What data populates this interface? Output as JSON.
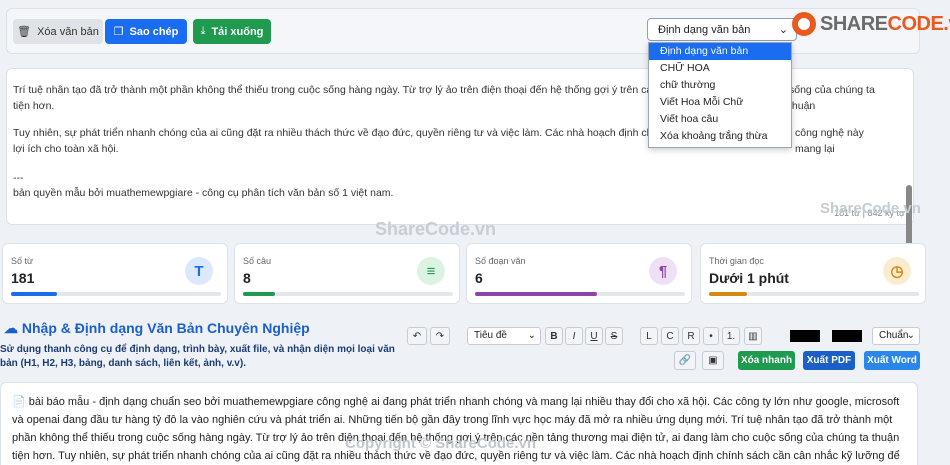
{
  "toolbar": {
    "clear_label": "Xóa văn bản",
    "copy_label": "Sao chép",
    "download_label": "Tải xuống"
  },
  "format_select": {
    "selected": "Định dạng văn bản",
    "options": [
      "Định dạng văn bản",
      "CHỮ HOA",
      "chữ thường",
      "Viết Hoa Mỗi Chữ",
      "Viết hoa câu",
      "Xóa khoảng trắng thừa"
    ]
  },
  "logo": {
    "share": "SHARE",
    "code": "CODE.vn"
  },
  "textarea": {
    "line1": "Trí tuệ nhân tạo đã trở thành một phần không thể thiếu trong cuộc sống hàng ngày. Từ trợ lý ảo trên điện thoại đến hệ thống gợi ý trên các nền tảng",
    "line1b": "sống của chúng ta thuận",
    "line2": "tiện hơn.",
    "line3": "Tuy nhiên, sự phát triển nhanh chóng của ai cũng đặt ra nhiều thách thức về đạo đức, quyền riêng tư và việc làm. Các nhà hoạch định chính sách cầ",
    "line3b": "công nghệ này mang lại",
    "line4": "lợi ích cho toàn xã hội.",
    "line5": "---",
    "line6": "bản quyền mẫu bởi muathemewpgiare - công cụ phân tích văn bản số 1 việt nam.",
    "counter": "181 từ | 842 ký tự"
  },
  "watermarks": {
    "mid": "ShareCode.vn",
    "right": "ShareCode.vn",
    "bottom": "Copyright © ShareCode.vn"
  },
  "stats": [
    {
      "label": "Số từ",
      "value": "181",
      "color": "#1a6cf0",
      "progress": 0.22,
      "icon": "T"
    },
    {
      "label": "Số câu",
      "value": "8",
      "color": "#1f9a4e",
      "progress": 0.15,
      "icon": "≡"
    },
    {
      "label": "Số đoạn văn",
      "value": "6",
      "color": "#8e44ad",
      "progress": 0.58,
      "icon": "¶"
    },
    {
      "label": "Thời gian đọc",
      "value": "Dưới 1 phút",
      "color": "#d68910",
      "progress": 0.18,
      "icon": "◷"
    }
  ],
  "editor": {
    "title": "Nhập & Định dạng Văn Bản Chuyên Nghiệp",
    "subtitle": "Sử dụng thanh công cụ để định dạng, trình bày, xuất file, và nhận diện mọi loại văn bản (H1, H2, H3, bảng, danh sách, liên kết, ảnh, v.v).",
    "heading_select": "Tiêu đề",
    "align_select": "Chuẩn",
    "buttons": {
      "b": "B",
      "i": "I",
      "u": "U",
      "s": "S",
      "l": "L",
      "c": "C",
      "r": "R",
      "dot": "•",
      "num": "1.",
      "undo": "↶",
      "redo": "↷"
    },
    "clear_label": "Xóa nhanh",
    "pdf_label": "Xuất PDF",
    "word_label": "Xuất Word",
    "content": "📄 bài báo mẫu - định dạng chuẩn seo bởi muathemewpgiare công nghệ ai đang phát triển nhanh chóng và mang lại nhiều thay đổi cho xã hội. Các công ty lớn như google, microsoft và openai đang đầu tư hàng tỷ đô la vào nghiên cứu và phát triển ai. Những tiến bộ gần đây trong lĩnh vực học máy đã mở ra nhiều ứng dụng mới. Trí tuệ nhân tạo đã trở thành một phần không thể thiếu trong cuộc sống hàng ngày. Từ trợ lý ảo trên điện thoại đến hệ thống gợi ý trên các nền tảng thương mại điện tử, ai đang làm cho cuộc sống của chúng ta thuận tiện hơn. Tuy nhiên, sự phát triển nhanh chóng của ai cũng đặt ra nhiều thách thức về đạo đức, quyền riêng tư và việc làm. Các nhà hoạch định chính sách cần cân nhắc kỹ lưỡng để đảm bảo công nghệ này mang lại lợi ích cho toàn xã hội. --- bản quyền mẫu bởi muathemewpgiare - công cụ phân tích văn bản số 1 việt nam."
  }
}
